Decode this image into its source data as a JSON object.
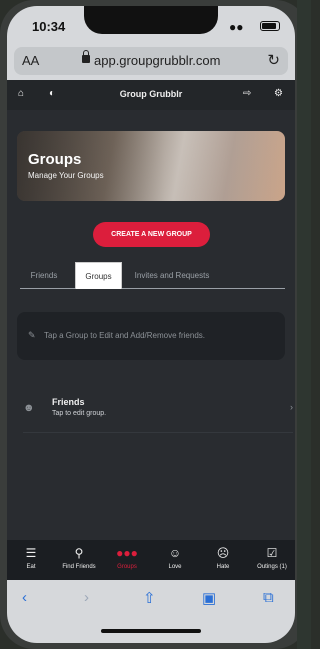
{
  "status_bar": {
    "time": "10:34"
  },
  "browser": {
    "aa_label": "AA",
    "url": "app.groupgrubblr.com"
  },
  "app_header": {
    "title": "Group Grubblr"
  },
  "hero": {
    "title": "Groups",
    "subtitle": "Manage Your Groups"
  },
  "create_button": {
    "label": "CREATE A NEW GROUP"
  },
  "tabs": [
    {
      "label": "Friends",
      "active": false
    },
    {
      "label": "Groups",
      "active": true
    },
    {
      "label": "Invites and Requests",
      "active": false
    }
  ],
  "hint": {
    "text": "Tap a Group to Edit and Add/Remove friends."
  },
  "groups": [
    {
      "name": "Friends",
      "subtitle": "Tap to edit group."
    }
  ],
  "bottom_nav": [
    {
      "label": "Eat",
      "icon": "utensils-icon",
      "active": false
    },
    {
      "label": "Find Friends",
      "icon": "search-icon",
      "active": false
    },
    {
      "label": "Groups",
      "icon": "users-icon",
      "active": true
    },
    {
      "label": "Love",
      "icon": "smile-icon",
      "active": false
    },
    {
      "label": "Hate",
      "icon": "frown-icon",
      "active": false
    },
    {
      "label": "Outings (1)",
      "icon": "calendar-check-icon",
      "active": false
    }
  ],
  "colors": {
    "accent": "#dc1e3c",
    "background": "#292c30",
    "header": "#232629"
  }
}
